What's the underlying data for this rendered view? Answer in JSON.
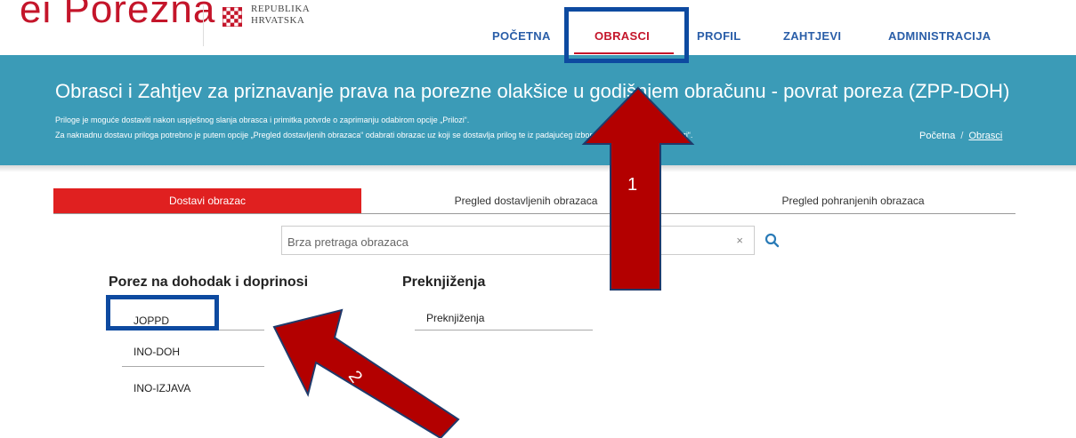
{
  "logo": {
    "text": "ei Porezna",
    "coat_line1": "REPUBLIKA",
    "coat_line2": "HRVATSKA"
  },
  "nav": {
    "items": [
      {
        "label": "POČETNA"
      },
      {
        "label": "OBRASCI"
      },
      {
        "label": "PROFIL"
      },
      {
        "label": "ZAHTJEVI"
      },
      {
        "label": "ADMINISTRACIJA"
      }
    ]
  },
  "banner": {
    "title": "Obrasci i Zahtjev za priznavanje prava na porezne olakšice u godišnjem obračunu - povrat poreza (ZPP-DOH)",
    "note1": "Priloge je moguće dostaviti nakon uspješnog slanja obrasca i primitka potvrde o zaprimanju odabirom opcije „Prilozi“.",
    "note2": "Za naknadnu dostavu priloga potrebno je putem opcije „Pregled dostavljenih obrazaca“ odabrati obrazac uz koji se dostavlja prilog te iz padajućeg izbornika odabrati opciju „Prilozi“."
  },
  "breadcrumb": {
    "home": "Početna",
    "separator": "/",
    "current": "Obrasci"
  },
  "tabs": [
    {
      "label": "Dostavi obrazac"
    },
    {
      "label": "Pregled dostavljenih obrazaca"
    },
    {
      "label": "Pregled pohranjenih obrazaca"
    }
  ],
  "search": {
    "placeholder": "Brza pretraga obrazaca",
    "value": "",
    "clear": "×"
  },
  "sections": {
    "porez": {
      "title": "Porez na dohodak i doprinosi",
      "items": [
        "JOPPD",
        "INO-DOH",
        "INO-IZJAVA"
      ]
    },
    "preknjizenja": {
      "title": "Preknjiženja",
      "items": [
        "Preknjiženja"
      ]
    }
  },
  "annotations": {
    "arrow1": "1",
    "arrow2": "2"
  },
  "colors": {
    "accent": "#c4152a",
    "banner": "#3b9bb7",
    "nav_blue": "#2a5ea8",
    "highlight_box": "#0d4aa0",
    "arrow": "#b30000"
  }
}
